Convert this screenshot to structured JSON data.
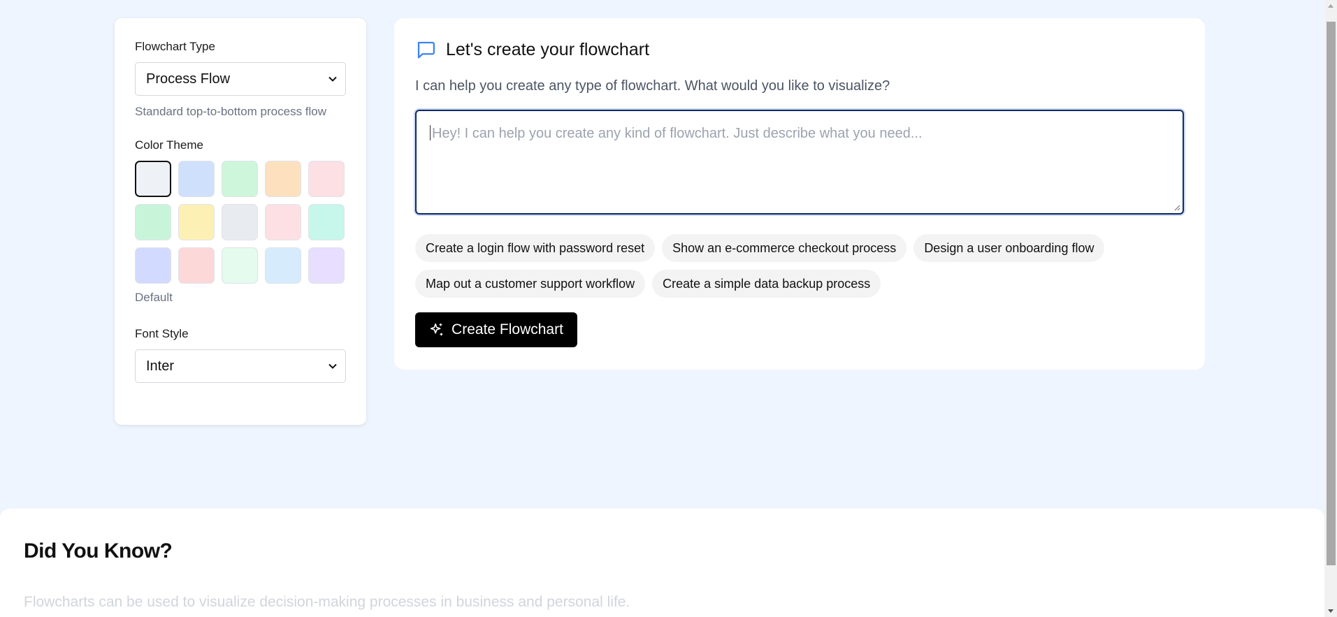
{
  "settings": {
    "flowchart_type_label": "Flowchart Type",
    "flowchart_type_value": "Process Flow",
    "flowchart_type_help": "Standard top-to-bottom process flow",
    "color_theme_label": "Color Theme",
    "swatches": [
      "#eef1f6",
      "#cfe0fd",
      "#cdf6da",
      "#fde1be",
      "#fde0e4",
      "#c8f5d9",
      "#fdf0b4",
      "#e8ebf0",
      "#fde0e4",
      "#c6f7ea",
      "#d3daff",
      "#fdd8d8",
      "#e4fbee",
      "#d6ecfd",
      "#e8deff"
    ],
    "selected_theme": "Default",
    "font_style_label": "Font Style",
    "font_style_value": "Inter"
  },
  "main": {
    "title": "Let's create your flowchart",
    "subtitle": "I can help you create any type of flowchart. What would you like to visualize?",
    "prompt_placeholder": "Hey! I can help you create any kind of flowchart. Just describe what you need...",
    "suggestions": [
      "Create a login flow with password reset",
      "Show an e-commerce checkout process",
      "Design a user onboarding flow",
      "Map out a customer support workflow",
      "Create a simple data backup process"
    ],
    "create_button_label": "Create Flowchart"
  },
  "did_you_know": {
    "heading": "Did You Know?",
    "fact": "Flowcharts can be used to visualize decision-making processes in business and personal life."
  },
  "colors": {
    "page_bg": "#eff5ff",
    "accent_blue": "#3b82f6",
    "focus_border": "#0f2a63",
    "button_bg": "#000000"
  }
}
